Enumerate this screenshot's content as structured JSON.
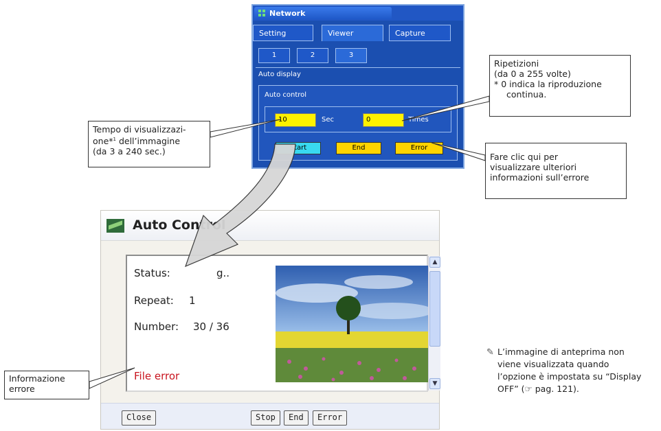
{
  "network_panel": {
    "title": "Network",
    "tabs": [
      "Setting",
      "Viewer",
      "Capture"
    ],
    "subtabs": [
      "1",
      "2",
      "3"
    ],
    "section_label": "Auto display",
    "box_label": "Auto control",
    "time_value": "10",
    "time_unit": "Sec",
    "repeat_value": "0",
    "repeat_unit": "Times",
    "buttons": {
      "start": "Start",
      "end": "End",
      "error": "Error"
    }
  },
  "callouts": {
    "repetitions": [
      "Ripetizioni",
      "(da 0 a 255 volte)",
      "* 0 indica la riproduzione",
      "continua."
    ],
    "display_time": {
      "line1": "Tempo di visualizzazi-",
      "line2_pre": "one*",
      "line2_sup": "1",
      "line2_post": " dell’immagine",
      "line3": "(da 3 a 240 sec.)"
    },
    "error_click": [
      "Fare clic qui per",
      "visualizzare ulteriori",
      "informazioni sull’errore"
    ],
    "error_info": [
      "Informazione",
      "errore"
    ]
  },
  "auto_control": {
    "title": "Auto Control",
    "status_label": "Status:",
    "status_value": "g..",
    "repeat_label": "Repeat:",
    "repeat_value": "1",
    "number_label": "Number:",
    "number_value": "30 / 36",
    "error_text": "File error",
    "buttons": {
      "close": "Close",
      "stop": "Stop",
      "end": "End",
      "error": "Error"
    }
  },
  "note": {
    "icon": "pencil-icon",
    "lines": [
      "L’immagine di anteprima non",
      "viene visualizzata quando",
      "l’opzione è impostata su “Display",
      "OFF” (☞ pag. 121)."
    ]
  }
}
